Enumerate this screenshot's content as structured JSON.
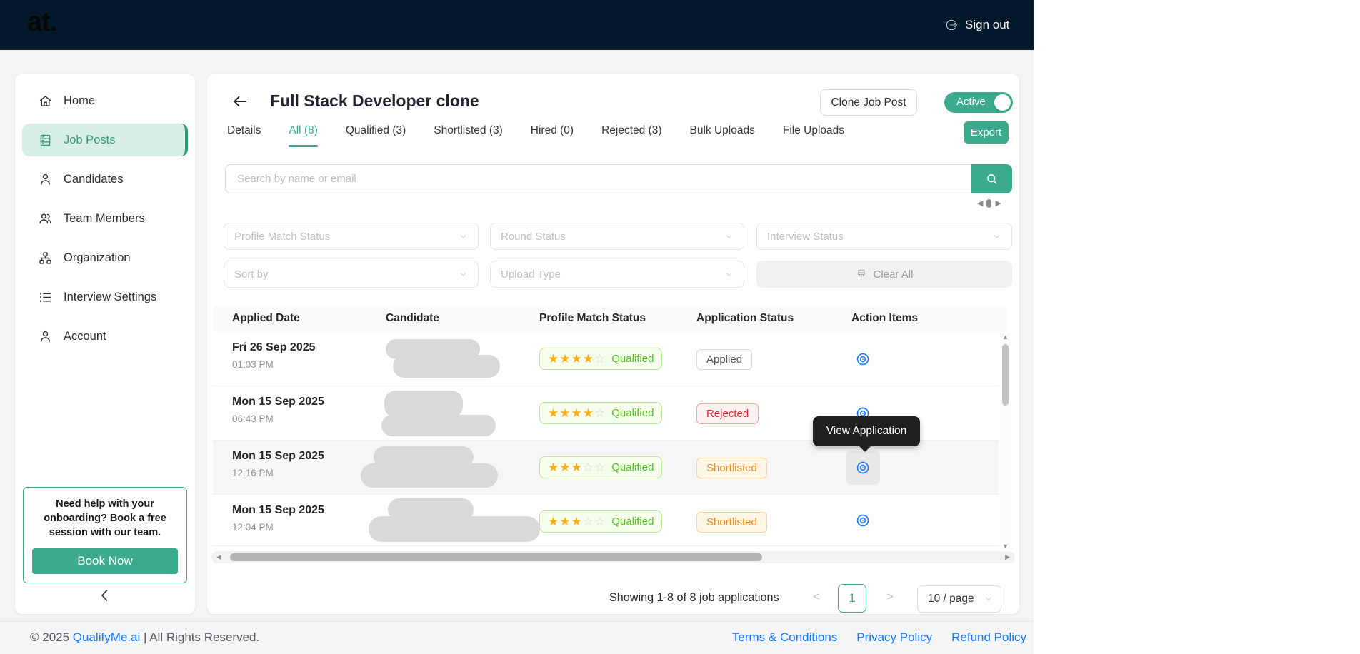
{
  "header": {
    "logo": "at.",
    "sign_out_label": "Sign out"
  },
  "sidebar": {
    "items": [
      {
        "label": "Home",
        "icon": "home-icon"
      },
      {
        "label": "Job Posts",
        "icon": "job-posts-icon",
        "active": true
      },
      {
        "label": "Candidates",
        "icon": "person-icon"
      },
      {
        "label": "Team Members",
        "icon": "team-icon"
      },
      {
        "label": "Organization",
        "icon": "org-chart-icon"
      },
      {
        "label": "Interview Settings",
        "icon": "list-icon"
      },
      {
        "label": "Account",
        "icon": "person-icon"
      }
    ],
    "help": {
      "text": "Need help with your onboarding? Book a free session with our team.",
      "button_label": "Book Now"
    }
  },
  "job": {
    "title": "Full Stack Developer clone",
    "clone_button_label": "Clone Job Post",
    "status_toggle_label": "Active",
    "toggle_on": true,
    "export_button_label": "Export",
    "tabs": [
      {
        "label": "Details"
      },
      {
        "label": "All (8)",
        "active": true
      },
      {
        "label": "Qualified (3)"
      },
      {
        "label": "Shortlisted (3)"
      },
      {
        "label": "Hired (0)"
      },
      {
        "label": "Rejected (3)"
      },
      {
        "label": "Bulk Uploads"
      },
      {
        "label": "File Uploads"
      }
    ]
  },
  "search": {
    "placeholder": "Search by name or email"
  },
  "filters": {
    "row1": [
      "Profile Match Status",
      "Round Status",
      "Interview Status"
    ],
    "row2": [
      "Sort by",
      "Upload Type"
    ],
    "clear_all_label": "Clear All"
  },
  "table": {
    "columns": [
      "Applied Date",
      "Candidate",
      "Profile Match Status",
      "Application Status",
      "Action Items"
    ],
    "rows": [
      {
        "date": "Fri 26 Sep 2025",
        "time": "01:03 PM",
        "rating": 4,
        "rating_max": 5,
        "match_label": "Qualified",
        "status": "Applied",
        "status_type": "applied"
      },
      {
        "date": "Mon 15 Sep 2025",
        "time": "06:43 PM",
        "rating": 4,
        "rating_max": 5,
        "match_label": "Qualified",
        "status": "Rejected",
        "status_type": "rejected"
      },
      {
        "date": "Mon 15 Sep 2025",
        "time": "12:16 PM",
        "rating": 3,
        "rating_max": 5,
        "match_label": "Qualified",
        "status": "Shortlisted",
        "status_type": "shortlisted"
      },
      {
        "date": "Mon 15 Sep 2025",
        "time": "12:04 PM",
        "rating": 3,
        "rating_max": 5,
        "match_label": "Qualified",
        "status": "Shortlisted",
        "status_type": "shortlisted"
      }
    ]
  },
  "tooltip": {
    "text": "View Application"
  },
  "pagination": {
    "summary": "Showing 1-8 of 8 job applications",
    "prev": "<",
    "page": "1",
    "next": ">",
    "page_size": "10 / page"
  },
  "footer": {
    "copyright_prefix": "© 2025 ",
    "brand": "QualifyMe.ai",
    "copyright_suffix": " | All Rights Reserved.",
    "links": [
      "Terms & Conditions",
      "Privacy Policy",
      "Refund Policy"
    ]
  },
  "icons": {
    "carousel_prev": "◀",
    "carousel_next": "▶",
    "scroll_left": "◀",
    "scroll_right": "▶",
    "scroll_up": "▲",
    "scroll_down": "▼",
    "star_filled": "★",
    "star_empty": "☆"
  },
  "colors": {
    "accent_green": "#3cab8d",
    "header_navy": "#04182b",
    "eye_blue": "#1677ff",
    "star_orange": "#faad14",
    "qualified_green": "#52c41a",
    "rejected_red": "#f5222d",
    "shortlisted_orange": "#fa8c16",
    "link_blue": "#1677ff"
  }
}
